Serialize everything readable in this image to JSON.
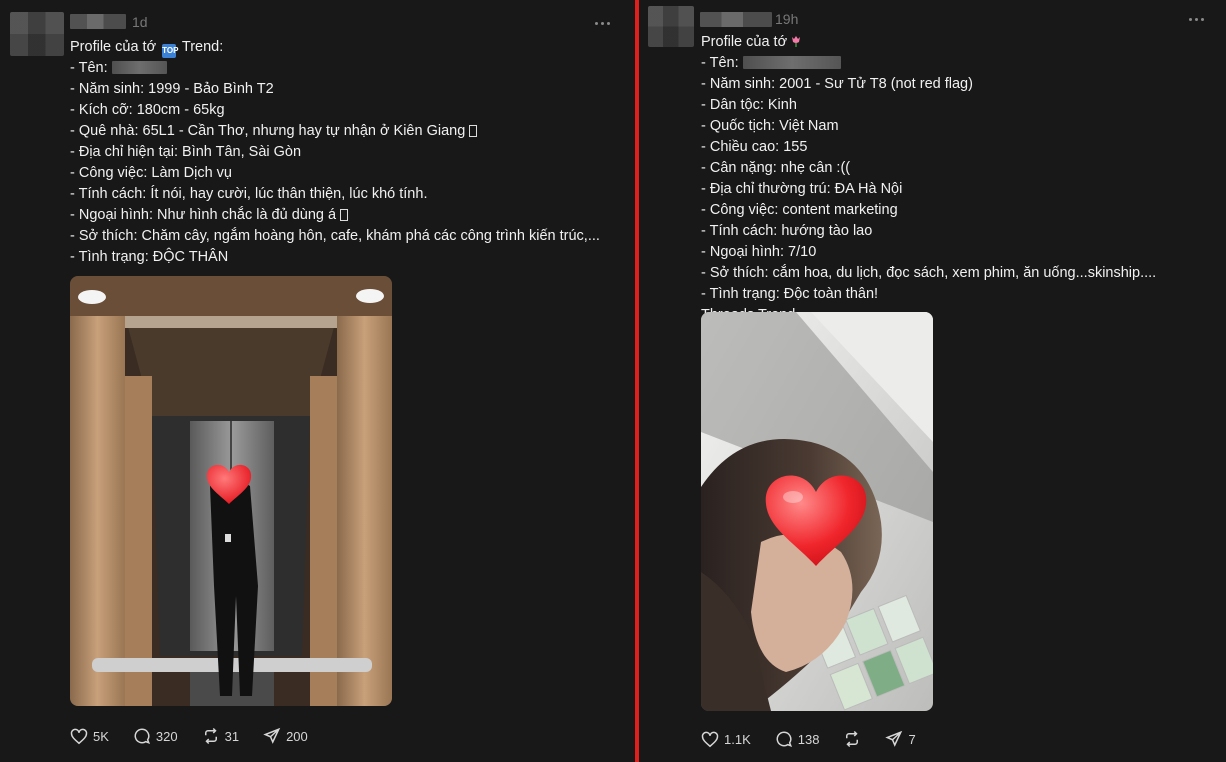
{
  "left_post": {
    "timestamp": "1d",
    "lines": [
      "Profile của tớ",
      "- Tên:",
      "- Năm sinh: 1999 - Bảo Bình T2",
      "- Kích cỡ: 180cm - 65kg",
      "- Quê nhà: 65L1 - Cần Thơ, nhưng hay tự nhận ở Kiên Giang",
      "- Địa chỉ hiện tại: Bình Tân, Sài Gòn",
      "- Công việc: Làm Dịch vụ",
      "- Tính cách: Ít nói, hay cười, lúc thân thiện, lúc khó tính.",
      "- Ngoại hình: Như hình chắc là đủ dùng á",
      "- Sở thích: Chăm cây, ngắm hoàng hôn, cafe, khám phá các công trình kiến trúc,...",
      "- Tình trạng: ĐỘC THÂN"
    ],
    "title_suffix": "Trend:",
    "trend_emoji_text": "TOP",
    "actions": {
      "likes": "5K",
      "comments": "320",
      "reposts": "31",
      "shares": "200"
    }
  },
  "right_post": {
    "timestamp": "19h",
    "title": "Profile của tớ",
    "lines": [
      "- Tên:",
      "- Năm sinh: 2001 - Sư Tử T8 (not red flag)",
      "- Dân tộc: Kinh",
      "- Quốc tịch: Việt Nam",
      "- Chiều cao: 155",
      "- Cân nặng: nhẹ cân :((",
      "- Địa chỉ thường trú: ĐA Hà Nội",
      "- Công việc: content marketing",
      "- Tính cách: hướng tào lao",
      "- Ngoại hình: 7/10",
      "- Sở thích: cắm hoa, du lịch, đọc sách, xem phim, ăn uống...skinship....",
      "- Tình trạng: Độc toàn thân!",
      "Threads Trend"
    ],
    "actions": {
      "likes": "1.1K",
      "comments": "138",
      "shares": "7"
    }
  },
  "colors": {
    "background": "#181818",
    "divider": "#e0201b",
    "text": "#f1f1f1",
    "muted": "#777777"
  }
}
